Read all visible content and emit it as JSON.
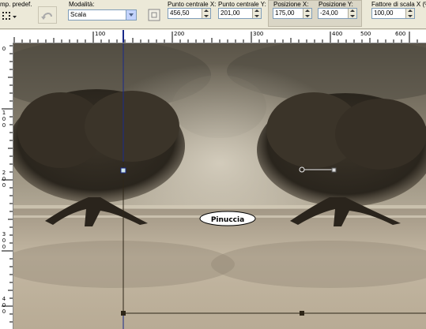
{
  "toolbar": {
    "preset_label": "mp. predef.",
    "mode_label": "Modalità:",
    "mode_value": "Scala",
    "center_x_label": "Punto centrale X:",
    "center_x_value": "456,50",
    "center_y_label": "Punto centrale Y:",
    "center_y_value": "201,00",
    "pos_x_label": "Posizione X:",
    "pos_x_value": "175,00",
    "pos_y_label": "Posizione Y:",
    "pos_y_value": "-24,00",
    "scale_x_label": "Fattore di scala X (%)",
    "scale_x_value": "100,00"
  },
  "ruler": {
    "top_labels": [
      "100",
      "200",
      "300",
      "400",
      "500",
      "600"
    ],
    "left_labels": [
      "0",
      "1",
      "0",
      "0",
      "2",
      "0",
      "0",
      "3",
      "0",
      "0",
      "4",
      "0",
      "0"
    ]
  },
  "canvas": {
    "watermark_text": "Pinuccia"
  },
  "colors": {
    "toolbar_bg": "#ece9d8",
    "guide_line": "#1a2a8a",
    "selection": "#2e2618"
  }
}
